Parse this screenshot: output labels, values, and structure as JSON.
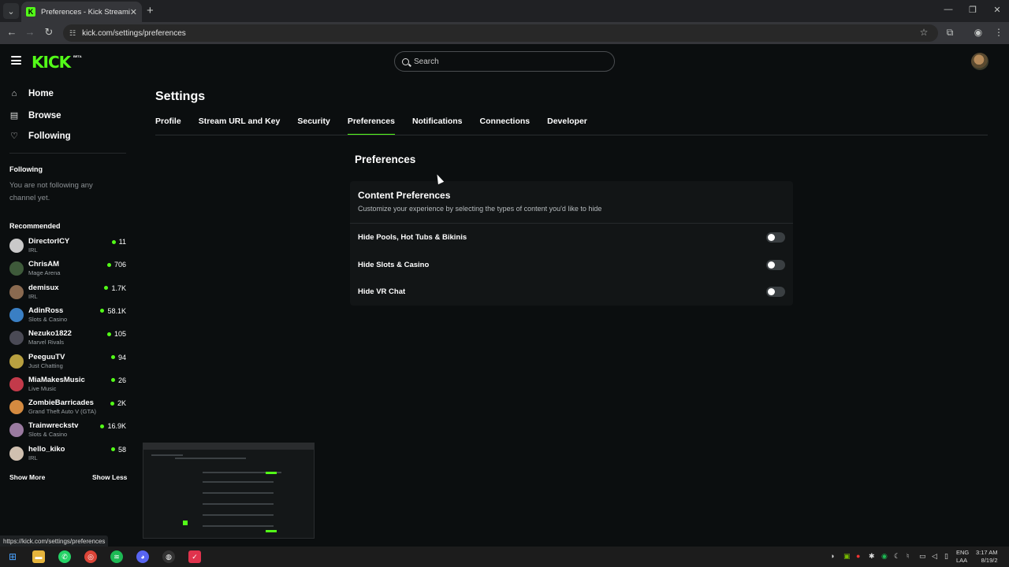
{
  "browser": {
    "tab_title": "Preferences - Kick Streaming",
    "tab_close": "✕",
    "new_tab": "+",
    "url": "kick.com/settings/preferences",
    "status_url": "https://kick.com/settings/preferences"
  },
  "header": {
    "logo": "KICK",
    "beta": "BETA",
    "search_placeholder": "Search"
  },
  "sidebar": {
    "nav": [
      {
        "label": "Home",
        "icon": "home-icon"
      },
      {
        "label": "Browse",
        "icon": "browse-icon"
      },
      {
        "label": "Following",
        "icon": "heart-icon"
      }
    ],
    "following_title": "Following",
    "following_note": "You are not following any channel yet.",
    "recommended_title": "Recommended",
    "recommended": [
      {
        "name": "DirectorICY",
        "category": "IRL",
        "viewers": "11",
        "color": "#c9c9c9"
      },
      {
        "name": "ChrisAM",
        "category": "Mage Arena",
        "viewers": "706",
        "color": "#3e5a3a"
      },
      {
        "name": "demisux",
        "category": "IRL",
        "viewers": "1.7K",
        "color": "#8a6a50"
      },
      {
        "name": "AdinRoss",
        "category": "Slots & Casino",
        "viewers": "58.1K",
        "color": "#3a7fc4"
      },
      {
        "name": "Nezuko1822",
        "category": "Marvel Rivals",
        "viewers": "105",
        "color": "#4a4a55"
      },
      {
        "name": "PeeguuTV",
        "category": "Just Chatting",
        "viewers": "94",
        "color": "#b8a040"
      },
      {
        "name": "MiaMakesMusic",
        "category": "Live Music",
        "viewers": "26",
        "color": "#c23a4a"
      },
      {
        "name": "ZombieBarricades",
        "category": "Grand Theft Auto V (GTA)",
        "viewers": "2K",
        "color": "#d48a40"
      },
      {
        "name": "Trainwreckstv",
        "category": "Slots & Casino",
        "viewers": "16.9K",
        "color": "#9a7aa0"
      },
      {
        "name": "hello_kiko",
        "category": "IRL",
        "viewers": "58",
        "color": "#d0c0b0"
      }
    ],
    "show_more": "Show More",
    "show_less": "Show Less"
  },
  "settings": {
    "title": "Settings",
    "tabs": [
      "Profile",
      "Stream URL and Key",
      "Security",
      "Preferences",
      "Notifications",
      "Connections",
      "Developer"
    ],
    "active_tab": "Preferences",
    "section_title": "Preferences",
    "card_title": "Content Preferences",
    "card_desc": "Customize your experience by selecting the types of content you'd like to hide",
    "options": [
      {
        "label": "Hide Pools, Hot Tubs & Bikinis",
        "enabled": false
      },
      {
        "label": "Hide Slots & Casino",
        "enabled": false
      },
      {
        "label": "Hide VR Chat",
        "enabled": false
      }
    ]
  },
  "taskbar": {
    "lang_1": "ENG",
    "lang_2": "LAA",
    "time": "3:17 AM",
    "date": "8/19/2"
  },
  "colors": {
    "accent": "#53fc18",
    "background": "#0b0e0f",
    "card": "#121516"
  }
}
